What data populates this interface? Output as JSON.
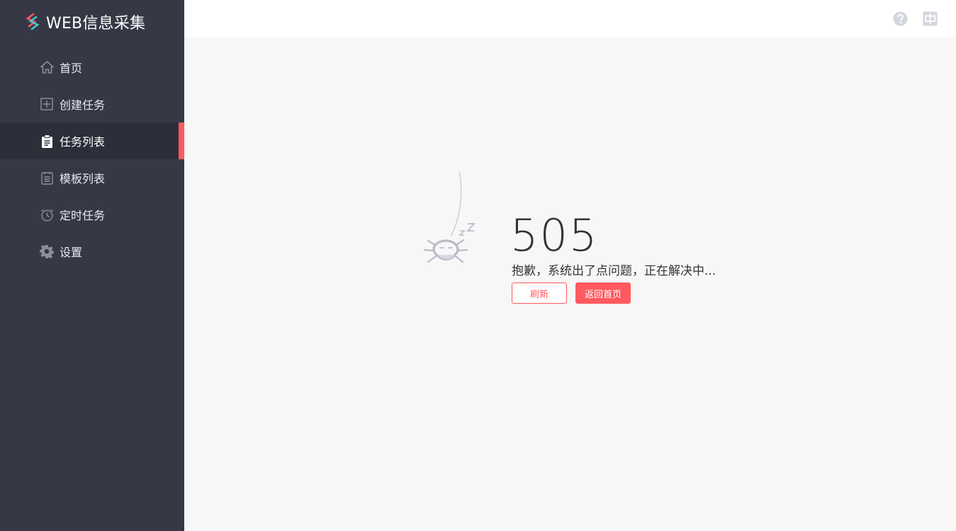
{
  "brand": {
    "title": "WEB信息采集"
  },
  "sidebar": {
    "items": [
      {
        "label": "首页",
        "icon": "home-icon",
        "active": false
      },
      {
        "label": "创建任务",
        "icon": "plus-square-icon",
        "active": false
      },
      {
        "label": "任务列表",
        "icon": "clipboard-icon",
        "active": true
      },
      {
        "label": "模板列表",
        "icon": "list-document-icon",
        "active": false
      },
      {
        "label": "定时任务",
        "icon": "alarm-clock-icon",
        "active": false
      },
      {
        "label": "设置",
        "icon": "gear-icon",
        "active": false
      }
    ]
  },
  "topbar": {
    "help_icon": "question-circle-icon",
    "language_icon": "chinese-language-icon"
  },
  "error": {
    "code": "505",
    "message": "抱歉，系统出了点问题，正在解决中...",
    "refresh_label": "刷新",
    "home_label": "返回首页"
  },
  "colors": {
    "sidebar_bg": "#363846",
    "active_bg": "#2c2e3a",
    "accent": "#ff5a5f",
    "content_bg": "#f7f7f7"
  }
}
